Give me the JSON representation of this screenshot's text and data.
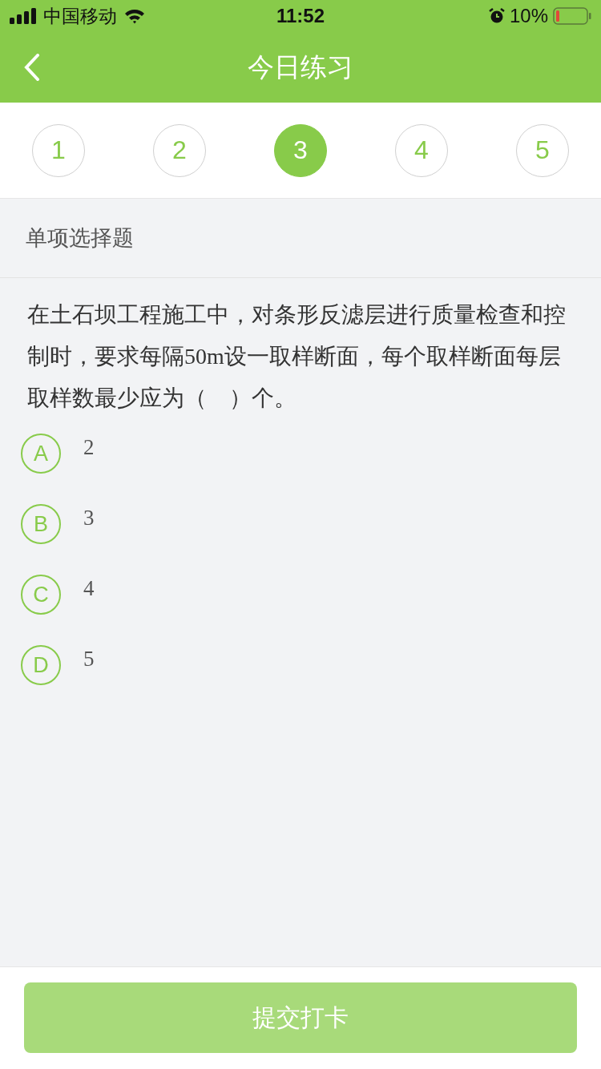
{
  "status_bar": {
    "carrier": "中国移动",
    "time": "11:52",
    "battery": "10%"
  },
  "nav": {
    "title": "今日练习"
  },
  "steps": [
    {
      "label": "1",
      "selected": false
    },
    {
      "label": "2",
      "selected": false
    },
    {
      "label": "3",
      "selected": true
    },
    {
      "label": "4",
      "selected": false
    },
    {
      "label": "5",
      "selected": false
    }
  ],
  "question": {
    "type": "单项选择题",
    "text": "在土石坝工程施工中，对条形反滤层进行质量检查和控制时，要求每隔50m设一取样断面，每个取样断面每层取样数最少应为（　）个。",
    "options": [
      {
        "letter": "A",
        "text": "2",
        "selected": false
      },
      {
        "letter": "B",
        "text": "3",
        "selected": false
      },
      {
        "letter": "C",
        "text": "4",
        "selected": false
      },
      {
        "letter": "D",
        "text": "5",
        "selected": false
      }
    ]
  },
  "submit": {
    "label": "提交打卡",
    "disabled": true
  }
}
